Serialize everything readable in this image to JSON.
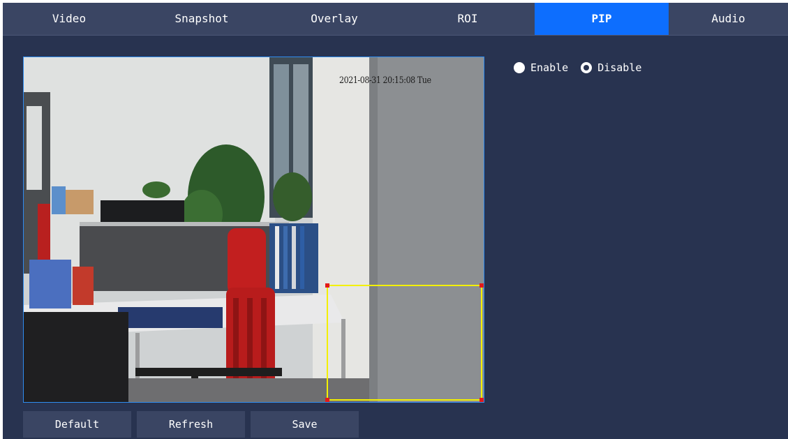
{
  "tabs": [
    {
      "label": "Video",
      "active": false
    },
    {
      "label": "Snapshot",
      "active": false
    },
    {
      "label": "Overlay",
      "active": false
    },
    {
      "label": "ROI",
      "active": false
    },
    {
      "label": "PIP",
      "active": true
    },
    {
      "label": "Audio",
      "active": false
    }
  ],
  "preview": {
    "osd_time": "2021-08-31 20:15:08 Tue"
  },
  "pip": {
    "enable_label": "Enable",
    "disable_label": "Disable",
    "selected": "Disable"
  },
  "buttons": {
    "default_label": "Default",
    "refresh_label": "Refresh",
    "save_label": "Save"
  },
  "colors": {
    "background": "#283350",
    "tab_bar": "#3a4563",
    "tab_active": "#0d6efe",
    "pip_box": "#f3f000",
    "pip_handle": "#e21a1a",
    "preview_border": "#2f8df0"
  }
}
